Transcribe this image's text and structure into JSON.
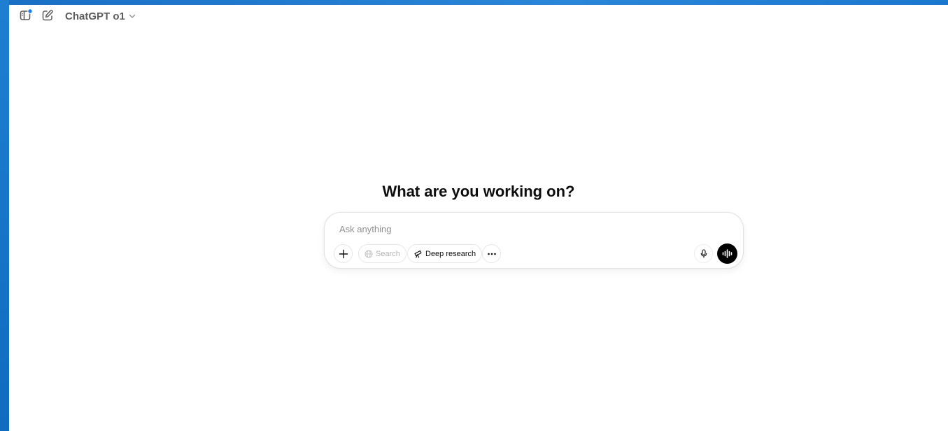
{
  "header": {
    "model_name": "ChatGPT o1",
    "icons": {
      "sidebar": "sidebar-toggle-icon",
      "new_chat": "new-chat-icon",
      "model_chevron": "chevron-down-icon"
    }
  },
  "main": {
    "headline": "What are you working on?"
  },
  "composer": {
    "placeholder": "Ask anything",
    "value": "",
    "tools": {
      "search_label": "Search",
      "deep_research_label": "Deep research"
    },
    "icons": {
      "attach": "plus-icon",
      "search": "globe-icon",
      "deep_research": "telescope-icon",
      "more": "more-icon",
      "dictate": "microphone-icon",
      "voice": "voice-waveform-icon"
    }
  },
  "colors": {
    "notification_dot": "#1a7fe8",
    "voice_button_bg": "#000000",
    "desktop_accent": "#0f72c8"
  }
}
